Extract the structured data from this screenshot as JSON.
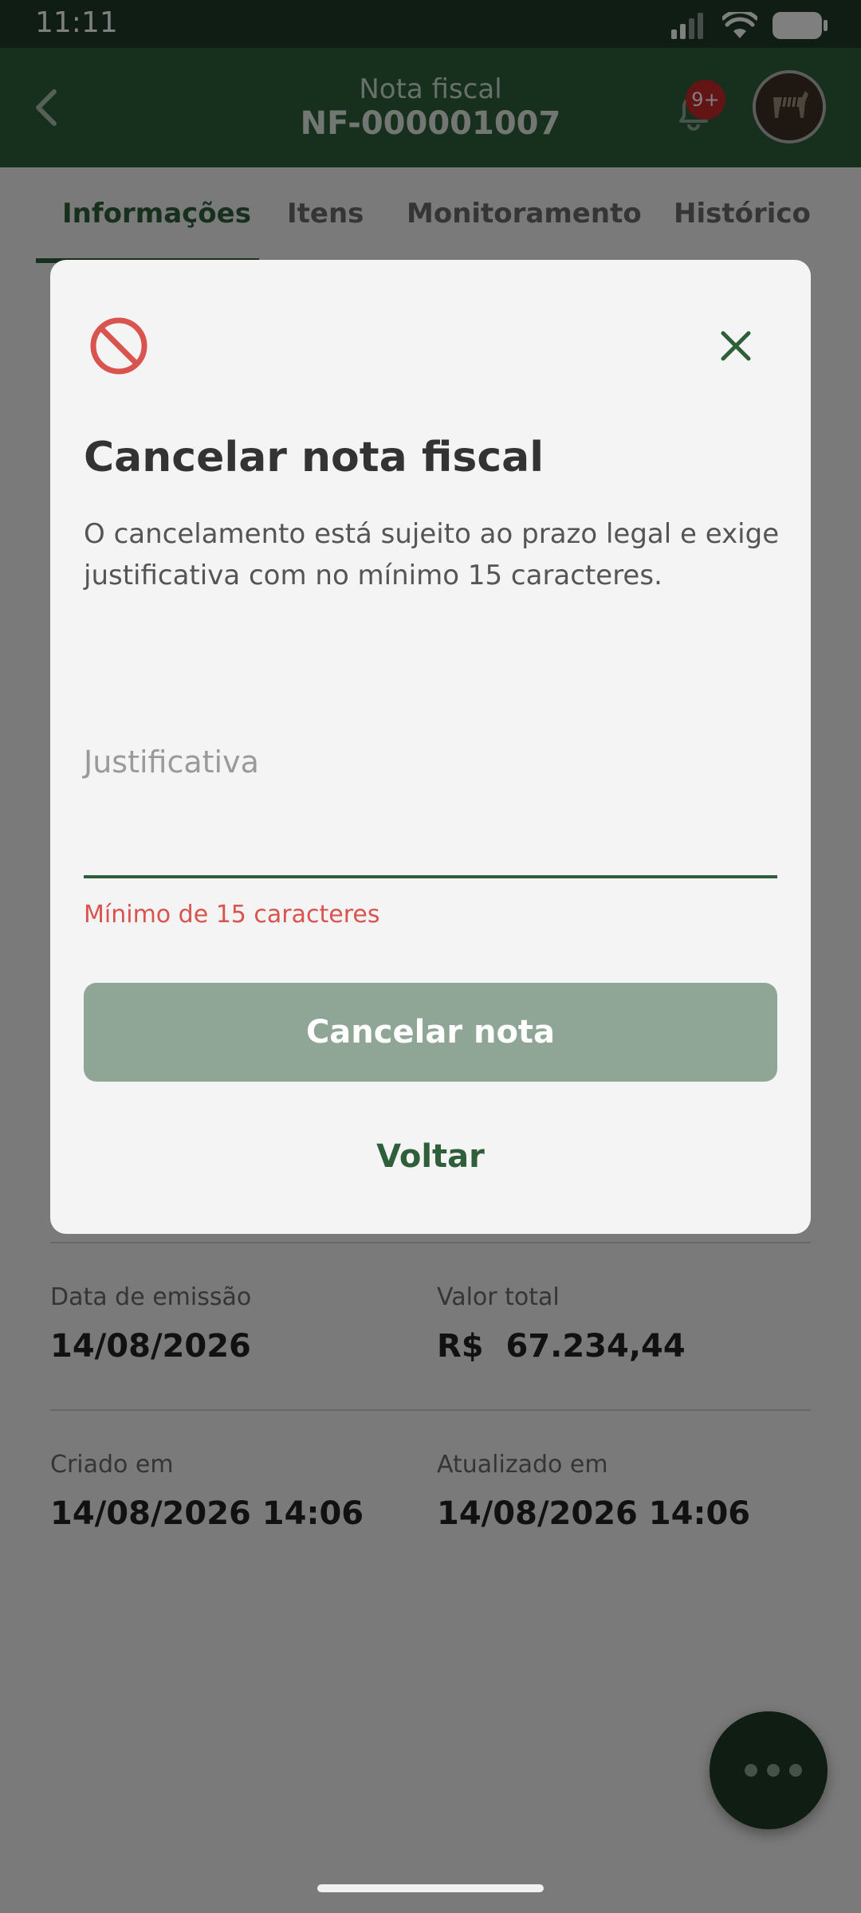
{
  "status_bar": {
    "time": "11:11"
  },
  "app_bar": {
    "subtitle": "Nota fiscal",
    "title": "NF-000001007",
    "notification_badge": "9+"
  },
  "tabs": [
    {
      "label": "Informações",
      "active": true
    },
    {
      "label": "Itens",
      "active": false
    },
    {
      "label": "Monitoramento",
      "active": false
    },
    {
      "label": "Histórico",
      "active": false
    }
  ],
  "details": {
    "emission_label": "Data de emissão",
    "emission_value": "14/08/2026",
    "total_label": "Valor total",
    "total_value": "R$  67.234,44",
    "created_label": "Criado em",
    "created_value": "14/08/2026 14:06",
    "updated_label": "Atualizado em",
    "updated_value": "14/08/2026 14:06"
  },
  "dialog": {
    "title": "Cancelar nota fiscal",
    "description": "O cancelamento está sujeito ao prazo legal e exige justificativa com no mínimo 15 caracteres.",
    "input_label": "Justificativa",
    "input_value": "",
    "error": "Mínimo de 15 caracteres",
    "primary_button": "Cancelar nota",
    "secondary_button": "Voltar"
  },
  "colors": {
    "primary": "#2f5f3a",
    "primary_disabled": "#8fa697",
    "error": "#d9534f",
    "badge": "#c62828"
  },
  "icons": {
    "back": "chevron-left-icon",
    "notifications": "bell-icon",
    "dialog_icon": "block-icon",
    "close": "close-icon",
    "fab": "more-horizontal-icon"
  }
}
